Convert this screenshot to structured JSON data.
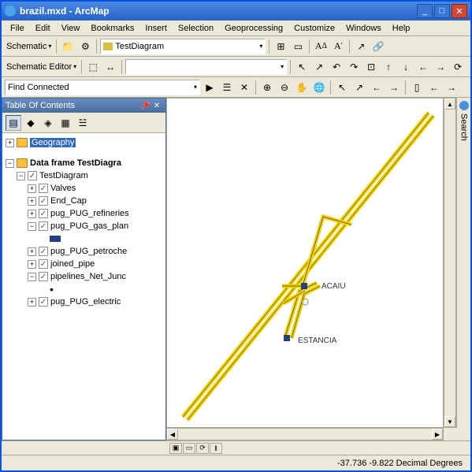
{
  "title": "brazil.mxd - ArcMap",
  "menu": [
    "File",
    "Edit",
    "View",
    "Bookmarks",
    "Insert",
    "Selection",
    "Geoprocessing",
    "Customize",
    "Windows",
    "Help"
  ],
  "toolbar1": {
    "schematic": "Schematic",
    "diagram": "TestDiagram"
  },
  "toolbar2": {
    "editor": "Schematic Editor"
  },
  "toolbar3": {
    "find": "Find Connected"
  },
  "toc": {
    "header": "Table Of Contents",
    "geography": "Geography",
    "dataframe": "Data frame TestDiagra",
    "root": "TestDiagram",
    "layers": [
      "Valves",
      "End_Cap",
      "pug_PUG_refineries",
      "pug_PUG_gas_plan",
      "pug_PUG_petroche",
      "joined_pipe",
      "pipelines_Net_Junc",
      "pug_PUG_electric"
    ]
  },
  "map": {
    "label1": "ACAIU",
    "label2": "ESTANCIA"
  },
  "sidepanel": "Search",
  "status": {
    "coords": "-37.736  -9.822 Decimal Degrees"
  }
}
